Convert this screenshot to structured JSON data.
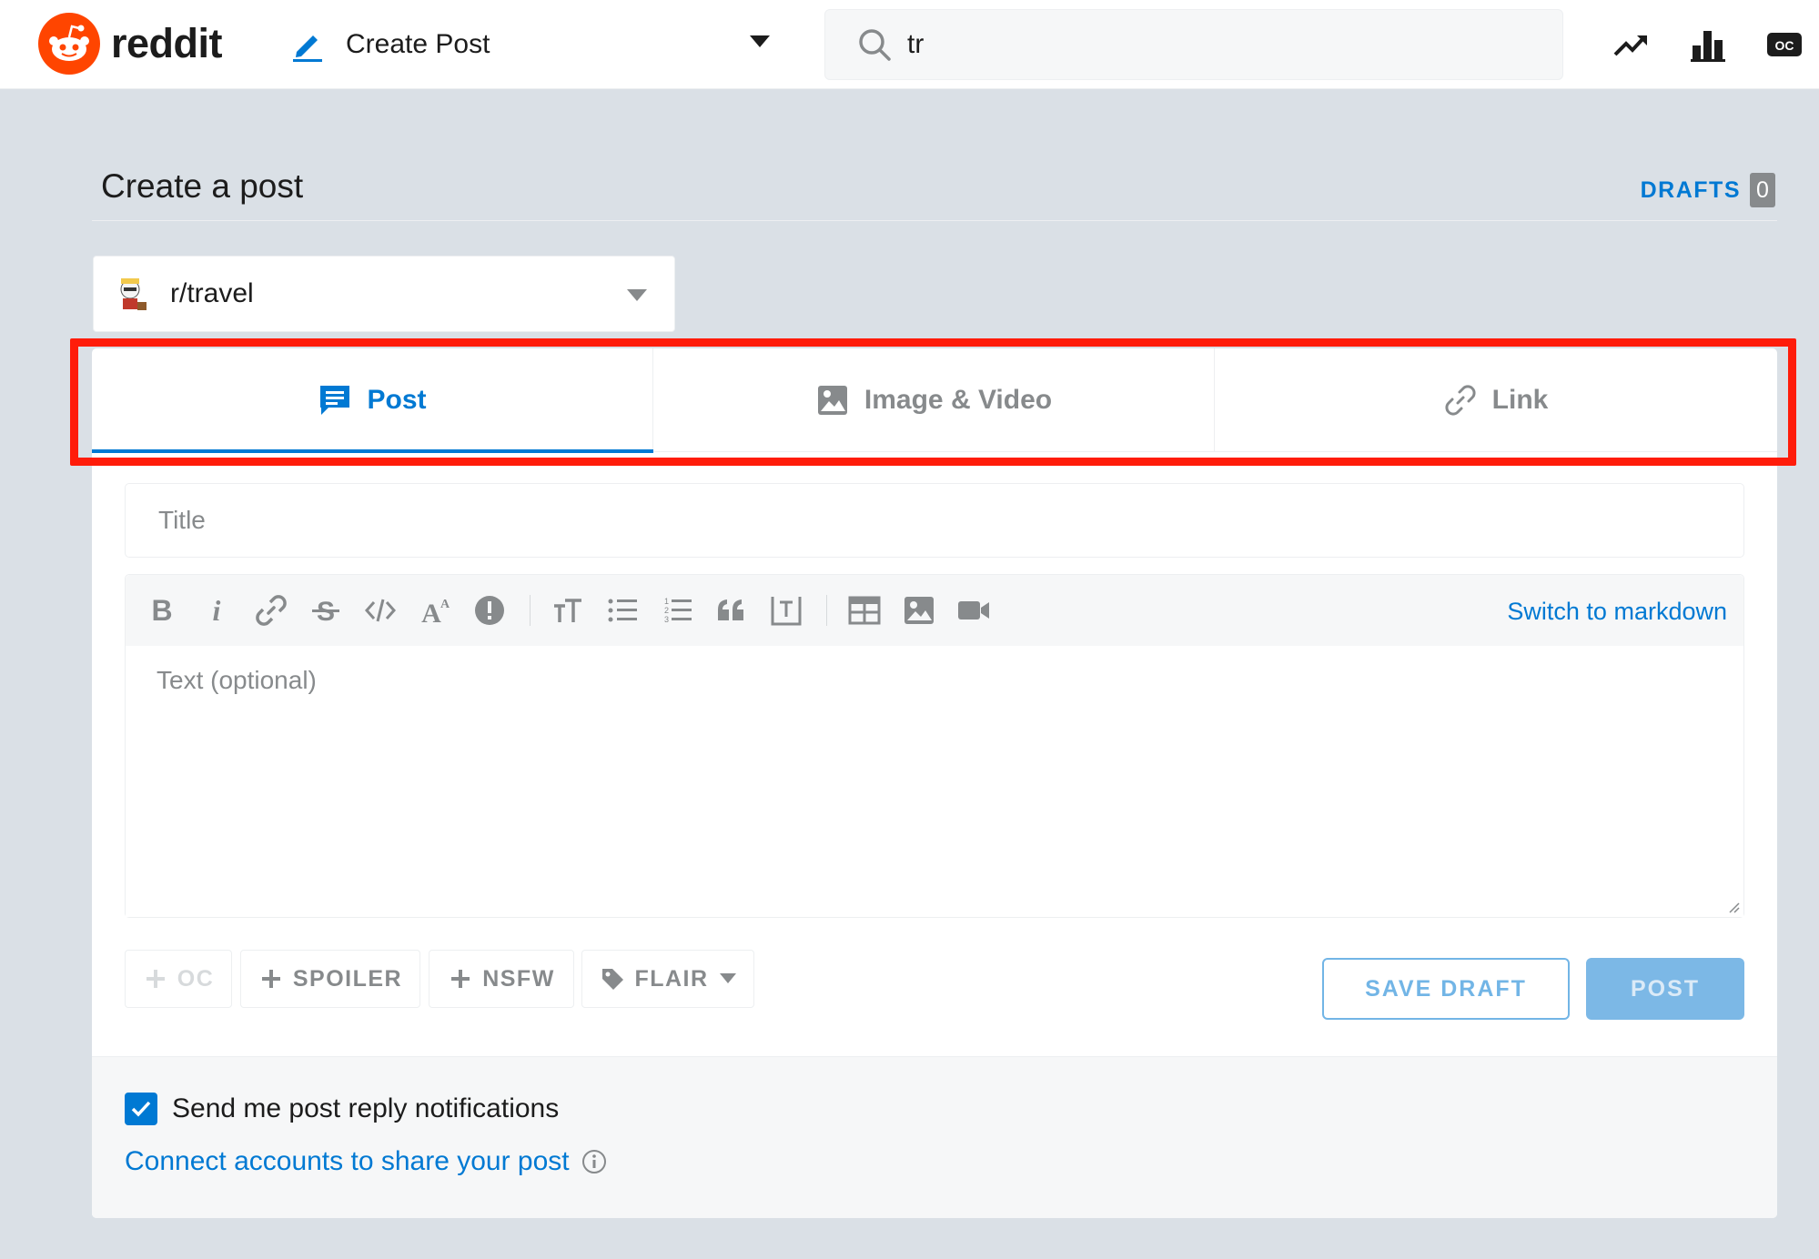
{
  "header": {
    "logo_text": "reddit",
    "page_switcher_label": "Create Post",
    "search_value": "tr",
    "icons": [
      "popular-icon",
      "all-icon",
      "oc-icon"
    ]
  },
  "main": {
    "title": "Create a post",
    "drafts_label": "DRAFTS",
    "drafts_count": "0",
    "community": "r/travel",
    "tabs": [
      {
        "label": "Post",
        "icon": "post-icon",
        "active": true
      },
      {
        "label": "Image & Video",
        "icon": "image-icon",
        "active": false
      },
      {
        "label": "Link",
        "icon": "link-icon",
        "active": false
      }
    ],
    "title_placeholder": "Title",
    "text_placeholder": "Text (optional)",
    "switch_markdown": "Switch to markdown",
    "toolbar_icons": [
      "bold",
      "italic",
      "link",
      "strikethrough",
      "inline-code",
      "superscript",
      "spoiler",
      "heading",
      "bulleted-list",
      "numbered-list",
      "quote-block",
      "code-block",
      "table",
      "image",
      "video"
    ],
    "tags": {
      "oc": "OC",
      "spoiler": "SPOILER",
      "nsfw": "NSFW",
      "flair": "FLAIR"
    },
    "save_draft": "SAVE DRAFT",
    "post": "POST",
    "notifications_label": "Send me post reply notifications",
    "notifications_checked": true,
    "connect_accounts": "Connect accounts to share your post"
  },
  "colors": {
    "accent": "#0079d3",
    "brand": "#ff4500",
    "highlight": "#ff1c0a",
    "page_bg": "#dae0e6"
  }
}
